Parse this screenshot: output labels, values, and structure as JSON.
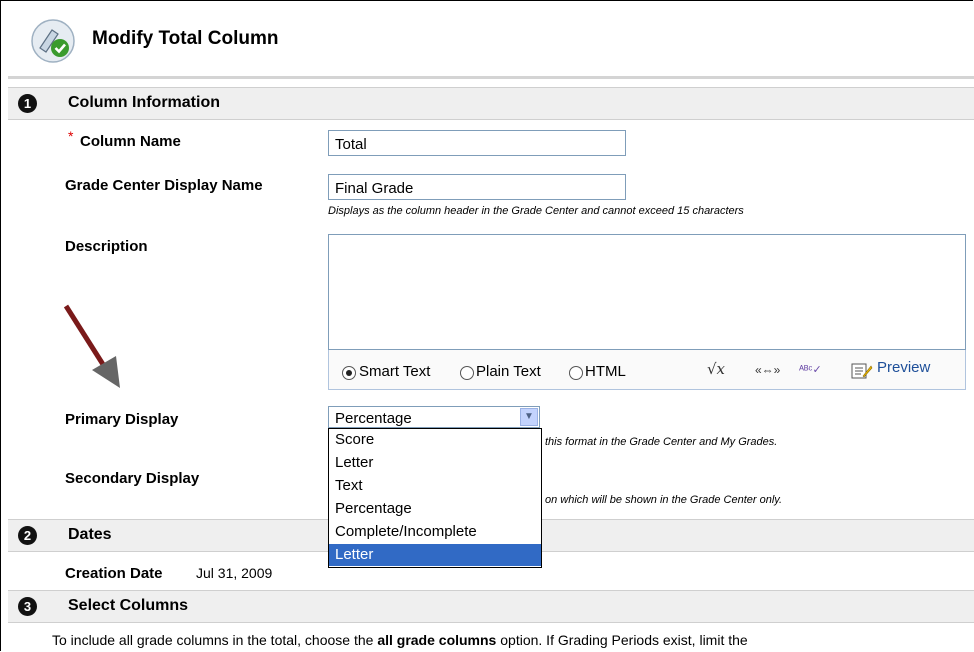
{
  "header": {
    "title": "Modify Total Column"
  },
  "sections": [
    {
      "number": "1",
      "title": "Column Information"
    },
    {
      "number": "2",
      "title": "Dates"
    },
    {
      "number": "3",
      "title": "Select Columns"
    }
  ],
  "column_info": {
    "required_marker": "*",
    "column_name_label": "Column Name",
    "column_name_value": "Total",
    "display_name_label": "Grade Center Display Name",
    "display_name_value": "Final Grade",
    "display_name_hint": "Displays as the column header in the Grade Center and cannot exceed 15 characters",
    "description_label": "Description",
    "editor": {
      "options": [
        "Smart Text",
        "Plain Text",
        "HTML"
      ],
      "selected": "Smart Text",
      "preview_label": "Preview",
      "icons": [
        "math-icon",
        "link-icon",
        "spellcheck-icon",
        "preview-icon"
      ]
    },
    "primary_display_label": "Primary Display",
    "primary_display_value": "Percentage",
    "primary_display_hint_partial": "this format in the Grade Center and My Grades.",
    "dropdown_options": [
      "Score",
      "Letter",
      "Text",
      "Percentage",
      "Complete/Incomplete",
      "Letter"
    ],
    "dropdown_highlighted_index": 5,
    "secondary_display_label": "Secondary Display",
    "secondary_display_hint_partial": "on which will be shown in the Grade Center only."
  },
  "dates": {
    "creation_label": "Creation Date",
    "creation_value": "Jul 31, 2009"
  },
  "select_columns": {
    "text_before": "To include all grade columns in the total, choose the ",
    "bold": "all grade columns",
    "text_after": " option. If Grading Periods exist, limit the"
  },
  "colors": {
    "arrow": "#7a1a1a",
    "highlight": "#316ac5",
    "section_bg": "#efefef",
    "link": "#1e4f99"
  }
}
